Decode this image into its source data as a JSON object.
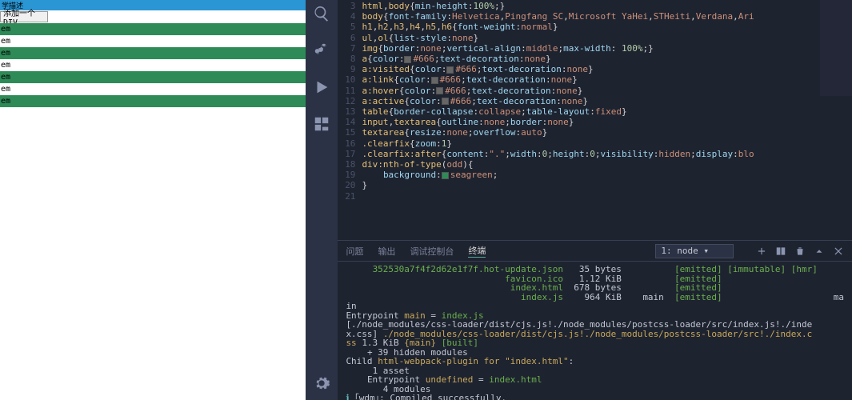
{
  "preview": {
    "header": "学描述",
    "button_label": "添加一个DIV",
    "row_text": "em"
  },
  "editor": {
    "lines": [
      {
        "n": 3,
        "html": "<span class='sel'>html</span><span class='punc'>,</span><span class='sel'>body</span><span class='punc'>{</span><span class='prop'>min-height</span><span class='punc'>:</span><span class='num'>100%</span><span class='punc'>;}</span>"
      },
      {
        "n": 4,
        "html": "<span class='sel'>body</span><span class='punc'>{</span><span class='prop'>font-family</span><span class='punc'>:</span><span class='val'>Helvetica</span><span class='punc'>,</span><span class='val'>Pingfang SC</span><span class='punc'>,</span><span class='val'>Microsoft YaHei</span><span class='punc'>,</span><span class='val'>STHeiti</span><span class='punc'>,</span><span class='val'>Verdana</span><span class='punc'>,</span><span class='val'>Ari</span>"
      },
      {
        "n": 5,
        "html": "<span class='sel'>h1</span><span class='punc'>,</span><span class='sel'>h2</span><span class='punc'>,</span><span class='sel'>h3</span><span class='punc'>,</span><span class='sel'>h4</span><span class='punc'>,</span><span class='sel'>h5</span><span class='punc'>,</span><span class='sel'>h6</span><span class='punc'>{</span><span class='prop'>font-weight</span><span class='punc'>:</span><span class='val'>normal</span><span class='punc'>}</span>"
      },
      {
        "n": 6,
        "html": "<span class='sel'>ul</span><span class='punc'>,</span><span class='sel'>ol</span><span class='punc'>{</span><span class='prop'>list-style</span><span class='punc'>:</span><span class='val'>none</span><span class='punc'>}</span>"
      },
      {
        "n": 7,
        "html": "<span class='sel'>img</span><span class='punc'>{</span><span class='prop'>border</span><span class='punc'>:</span><span class='val'>none</span><span class='punc'>;</span><span class='prop'>vertical-align</span><span class='punc'>:</span><span class='val'>middle</span><span class='punc'>;</span><span class='prop'>max-width</span><span class='punc'>: </span><span class='num'>100%</span><span class='punc'>;}</span>"
      },
      {
        "n": 8,
        "html": "<span class='sel'>a</span><span class='punc'>{</span><span class='prop'>color</span><span class='punc'>:</span><span class='swatch' style='background:#666'></span><span class='val'>#666</span><span class='punc'>;</span><span class='prop'>text-decoration</span><span class='punc'>:</span><span class='val'>none</span><span class='punc'>}</span>"
      },
      {
        "n": 9,
        "html": "<span class='sel'>a</span><span class='pseudo'>:visited</span><span class='punc'>{</span><span class='prop'>color</span><span class='punc'>:</span><span class='swatch' style='background:#666'></span><span class='val'>#666</span><span class='punc'>;</span><span class='prop'>text-decoration</span><span class='punc'>:</span><span class='val'>none</span><span class='punc'>}</span>"
      },
      {
        "n": 10,
        "html": "<span class='sel'>a</span><span class='pseudo'>:link</span><span class='punc'>{</span><span class='prop'>color</span><span class='punc'>:</span><span class='swatch' style='background:#666'></span><span class='val'>#666</span><span class='punc'>;</span><span class='prop'>text-decoration</span><span class='punc'>:</span><span class='val'>none</span><span class='punc'>}</span>"
      },
      {
        "n": 11,
        "html": "<span class='sel'>a</span><span class='pseudo'>:hover</span><span class='punc'>{</span><span class='prop'>color</span><span class='punc'>:</span><span class='swatch' style='background:#666'></span><span class='val'>#666</span><span class='punc'>;</span><span class='prop'>text-decoration</span><span class='punc'>:</span><span class='val'>none</span><span class='punc'>}</span>"
      },
      {
        "n": 12,
        "html": "<span class='sel'>a</span><span class='pseudo'>:active</span><span class='punc'>{</span><span class='prop'>color</span><span class='punc'>:</span><span class='swatch' style='background:#666'></span><span class='val'>#666</span><span class='punc'>;</span><span class='prop'>text-decoration</span><span class='punc'>:</span><span class='val'>none</span><span class='punc'>}</span>"
      },
      {
        "n": 13,
        "html": "<span class='sel'>table</span><span class='punc'>{</span><span class='prop'>border-collapse</span><span class='punc'>:</span><span class='val'>collapse</span><span class='punc'>;</span><span class='prop'>table-layout</span><span class='punc'>:</span><span class='val'>fixed</span><span class='punc'>}</span>"
      },
      {
        "n": 14,
        "html": "<span class='sel'>input</span><span class='punc'>,</span><span class='sel'>textarea</span><span class='punc'>{</span><span class='prop'>outline</span><span class='punc'>:</span><span class='val'>none</span><span class='punc'>;</span><span class='prop'>border</span><span class='punc'>:</span><span class='val'>none</span><span class='punc'>}</span>"
      },
      {
        "n": 15,
        "html": "<span class='sel'>textarea</span><span class='punc'>{</span><span class='prop'>resize</span><span class='punc'>:</span><span class='val'>none</span><span class='punc'>;</span><span class='prop'>overflow</span><span class='punc'>:</span><span class='val'>auto</span><span class='punc'>}</span>"
      },
      {
        "n": 16,
        "html": "<span class='cls'>.clearfix</span><span class='punc'>{</span><span class='prop'>zoom</span><span class='punc'>:</span><span class='num'>1</span><span class='punc'>}</span>"
      },
      {
        "n": 17,
        "html": "<span class='cls'>.clearfix</span><span class='pseudo'>:after</span><span class='punc'>{</span><span class='prop'>content</span><span class='punc'>:</span><span class='val'>\".\"</span><span class='punc'>;</span><span class='prop'>width</span><span class='punc'>:</span><span class='num'>0</span><span class='punc'>;</span><span class='prop'>height</span><span class='punc'>:</span><span class='num'>0</span><span class='punc'>;</span><span class='prop'>visibility</span><span class='punc'>:</span><span class='val'>hidden</span><span class='punc'>;</span><span class='prop'>display</span><span class='punc'>:</span><span class='val'>blo</span>"
      },
      {
        "n": 18,
        "html": ""
      },
      {
        "n": 19,
        "html": "<span class='sel'>div</span><span class='pseudo'>:nth-of-type</span><span class='punc'>(</span><span class='val'>odd</span><span class='punc'>)</span><span class='punc'>{</span>"
      },
      {
        "n": 20,
        "html": "    <span class='prop'>background</span><span class='punc'>:</span><span class='swatch' style='background:#2e8b57'></span><span class='val'>seagreen</span><span class='punc'>;</span>"
      },
      {
        "n": 21,
        "html": "<span class='punc'>}</span>"
      }
    ]
  },
  "panel": {
    "tabs": [
      "问题",
      "输出",
      "调试控制台",
      "终端"
    ],
    "active_tab": 3,
    "terminal_selector": "1: node",
    "terminal_lines": [
      "     <span class='g'>352530a7f4f2d62e1f7f.hot-update.json</span>   35 bytes          <span class='g'>[emitted] [immutable]</span> <span class='g'>[hmr]</span>",
      "                              <span class='g'>favicon.ico</span>   1.12 KiB          <span class='g'>[emitted]</span>",
      "                               <span class='g'>index.html</span>  678 bytes          <span class='g'>[emitted]</span>",
      "                                 <span class='g'>index.js</span>    964 KiB    <span class='w'>main</span>  <span class='g'>[emitted]</span>                     ma",
      "<span class='w'>in</span>",
      "<span class='w'>Entrypoint</span> <span class='y'>main</span> <span class='w'>=</span> <span class='g'>index.js</span>",
      "<span class='w'>[./node_modules/css-loader/dist/cjs.js!./node_modules/postcss-loader/src/index.js!./inde</span>",
      "<span class='w'>x.css]</span> <span class='y'>./node_modules/css-loader/dist/cjs.js!./node_modules/postcss-loader/src!./index.c</span>",
      "<span class='y'>ss</span> <span class='w'>1.3 KiB</span> <span class='y'>{main}</span> <span class='g'>[built]</span>",
      "    <span class='w'>+ 39 hidden modules</span>",
      "<span class='w'>Child</span> <span class='y'>html-webpack-plugin for \"index.html\"</span><span class='w'>:</span>",
      "     <span class='w'>1 asset</span>",
      "    <span class='w'>Entrypoint</span> <span class='y'>undefined</span> <span class='w'>=</span> <span class='g'>index.html</span>",
      "       <span class='w'>4 modules</span>",
      "<span class='cy'>ℹ</span> <span class='w'>｢wdm｣: Compiled successfully.</span>"
    ]
  }
}
